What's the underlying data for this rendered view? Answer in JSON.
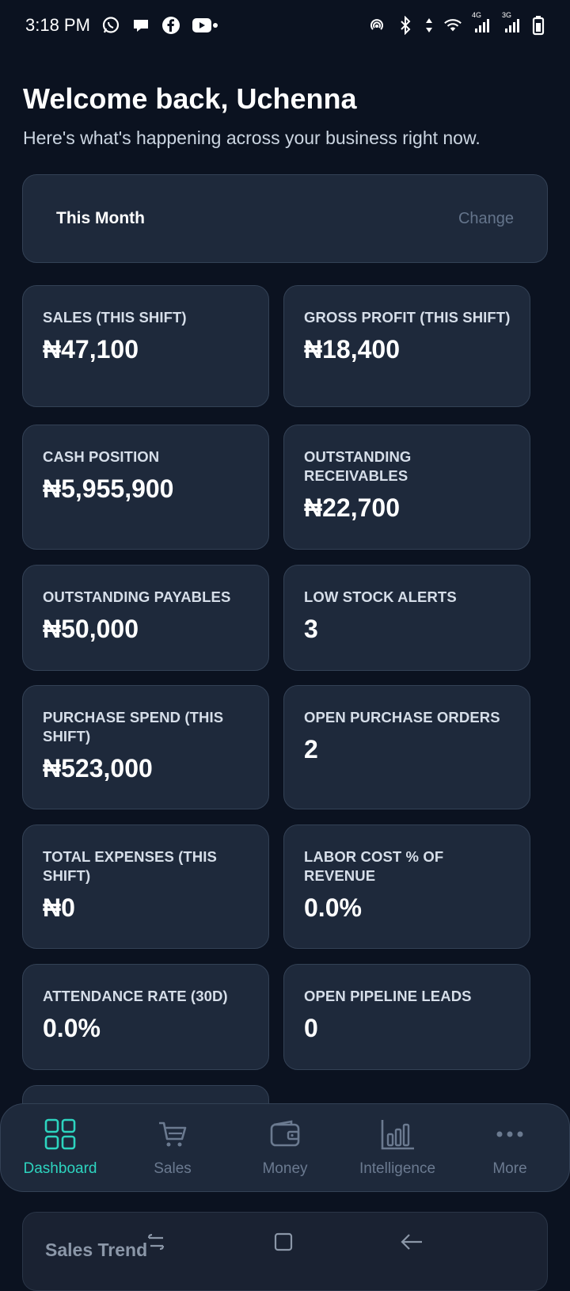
{
  "status_bar": {
    "time": "3:18 PM",
    "left_icons": [
      "whatsapp-icon",
      "chat-bubble-icon",
      "facebook-icon",
      "youtube-icon"
    ],
    "right_icons": [
      "hotspot-icon",
      "bluetooth-icon",
      "data-arrows-icon",
      "wifi-icon",
      "signal-4g-icon",
      "signal-3g-icon",
      "battery-icon"
    ],
    "network_4g": "4G",
    "network_3g": "3G"
  },
  "header": {
    "title": "Welcome back, Uchenna",
    "subtitle": "Here's what's happening across your business right now."
  },
  "period": {
    "label": "This Month",
    "change_label": "Change"
  },
  "kpis": [
    {
      "label": "SALES (THIS SHIFT)",
      "value": "₦47,100"
    },
    {
      "label": "GROSS PROFIT (THIS SHIFT)",
      "value": "₦18,400"
    },
    {
      "label": "CASH POSITION",
      "value": "₦5,955,900"
    },
    {
      "label": "OUTSTANDING RECEIVABLES",
      "value": "₦22,700"
    },
    {
      "label": "OUTSTANDING PAYABLES",
      "value": "₦50,000"
    },
    {
      "label": "LOW STOCK ALERTS",
      "value": "3"
    },
    {
      "label": "PURCHASE SPEND (THIS SHIFT)",
      "value": "₦523,000"
    },
    {
      "label": "OPEN PURCHASE ORDERS",
      "value": "2"
    },
    {
      "label": "TOTAL EXPENSES (THIS SHIFT)",
      "value": "₦0"
    },
    {
      "label": "LABOR COST % OF REVENUE",
      "value": "0.0%"
    },
    {
      "label": "ATTENDANCE RATE (30D)",
      "value": "0.0%"
    },
    {
      "label": "OPEN PIPELINE LEADS",
      "value": "0"
    }
  ],
  "bottom_nav": {
    "items": [
      {
        "label": "Dashboard",
        "icon": "grid-icon",
        "active": true
      },
      {
        "label": "Sales",
        "icon": "cart-icon",
        "active": false
      },
      {
        "label": "Money",
        "icon": "wallet-icon",
        "active": false
      },
      {
        "label": "Intelligence",
        "icon": "bar-chart-icon",
        "active": false
      },
      {
        "label": "More",
        "icon": "more-dots-icon",
        "active": false
      }
    ]
  },
  "sections": {
    "sales_trend_title": "Sales Trend"
  },
  "colors": {
    "background": "#0b1220",
    "card": "#1e293b",
    "border": "#334155",
    "accent": "#2dd4bf",
    "muted": "#6b7a90"
  }
}
